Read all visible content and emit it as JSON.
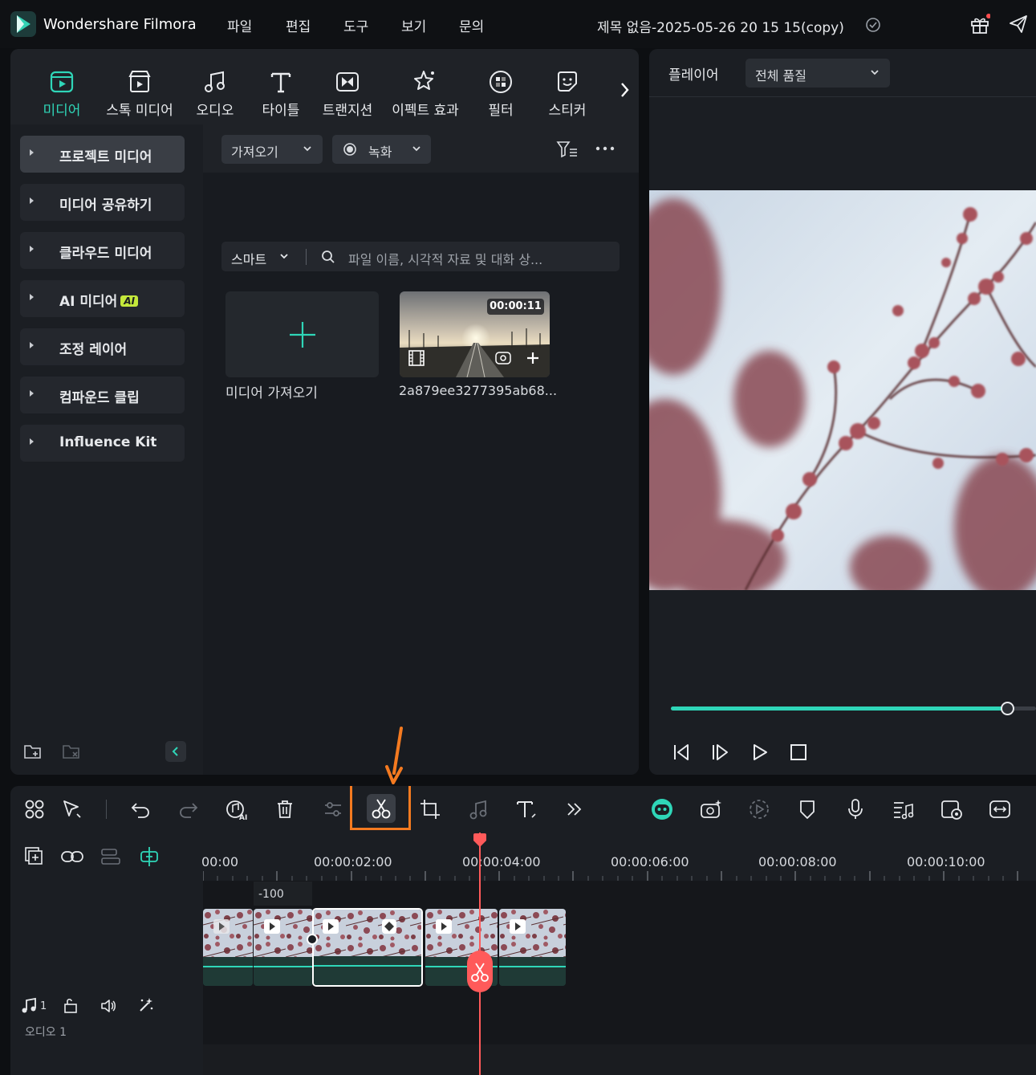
{
  "titlebar": {
    "app_name": "Wondershare Filmora",
    "menus": [
      "파일",
      "편집",
      "도구",
      "보기",
      "문의"
    ],
    "doc_title": "제목 없음-2025-05-26 20 15 15(copy)"
  },
  "media_tabs": [
    {
      "label": "미디어",
      "icon": "media-icon",
      "active": true
    },
    {
      "label": "스톡 미디어",
      "icon": "stock-media-icon"
    },
    {
      "label": "오디오",
      "icon": "music-note-icon"
    },
    {
      "label": "타이틀",
      "icon": "title-text-icon"
    },
    {
      "label": "트랜지션",
      "icon": "transition-icon"
    },
    {
      "label": "이펙트 효과",
      "icon": "effect-sparkle-icon"
    },
    {
      "label": "필터",
      "icon": "filter-icon"
    },
    {
      "label": "스티커",
      "icon": "sticker-icon"
    }
  ],
  "left_nav": [
    {
      "label": "프로젝트 미디어",
      "active": true
    },
    {
      "label": "미디어 공유하기"
    },
    {
      "label": "클라우드 미디어"
    },
    {
      "label": "AI 미디어",
      "badge": "AI"
    },
    {
      "label": "조정 레이어"
    },
    {
      "label": "컴파운드 클립"
    },
    {
      "label": "Influence Kit"
    }
  ],
  "media_toolbar": {
    "import_label": "가져오기",
    "record_label": "녹화",
    "smart_label": "스마트",
    "search_placeholder": "파일 이름, 시각적 자료 및 대화 상..."
  },
  "media_items": {
    "import_label": "미디어 가져오기",
    "clip_name": "2a879ee3277395ab68...",
    "clip_duration": "00:00:11"
  },
  "player": {
    "label": "플레이어",
    "quality": "전체 품질",
    "progress": 0.92
  },
  "timeline": {
    "ruler": [
      "00:00",
      "00:00:02:00",
      "00:00:04:00",
      "00:00:06:00",
      "00:00:08:00",
      "00:00:10:00"
    ],
    "offset_label": "-100",
    "audio_track_number": "1",
    "audio_track_label": "오디오 1"
  },
  "colors": {
    "accent": "#2fd6b8",
    "playhead": "#ff5a5a",
    "highlight": "#f47a20"
  }
}
